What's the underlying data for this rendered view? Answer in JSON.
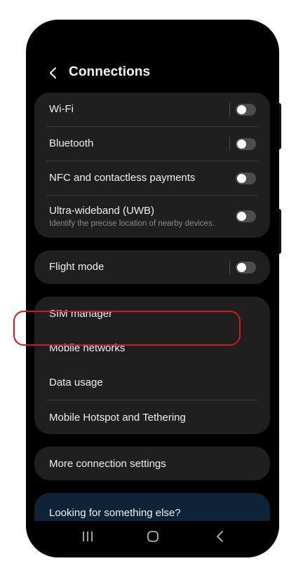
{
  "header": {
    "title": "Connections"
  },
  "sections": {
    "wifi": {
      "label": "Wi-Fi",
      "toggle_on": false
    },
    "bluetooth": {
      "label": "Bluetooth",
      "toggle_on": false
    },
    "nfc": {
      "label": "NFC and contactless payments",
      "toggle_on": false
    },
    "uwb": {
      "label": "Ultra-wideband (UWB)",
      "description": "Identify the precise location of nearby devices.",
      "toggle_on": false
    },
    "flight_mode": {
      "label": "Flight mode",
      "toggle_on": false
    },
    "sim_manager": {
      "label": "SIM manager"
    },
    "mobile_networks": {
      "label": "Mobile networks",
      "highlighted": true
    },
    "data_usage": {
      "label": "Data usage"
    },
    "hotspot": {
      "label": "Mobile Hotspot and Tethering"
    },
    "more_settings": {
      "label": "More connection settings"
    },
    "looking_for": {
      "label": "Looking for something else?"
    }
  },
  "icons": {
    "back": "chevron-left-icon",
    "nav_recent": "recent-apps-icon",
    "nav_home": "home-icon",
    "nav_back": "back-arrow-icon"
  },
  "colors": {
    "background": "#000000",
    "card": "#1f1f1f",
    "text": "#f0f0f0",
    "subtext": "#8b8b8b",
    "toggle_off": "#4d4d4d",
    "highlight": "#d11b1b",
    "suggestion_card": "#0e2338"
  }
}
